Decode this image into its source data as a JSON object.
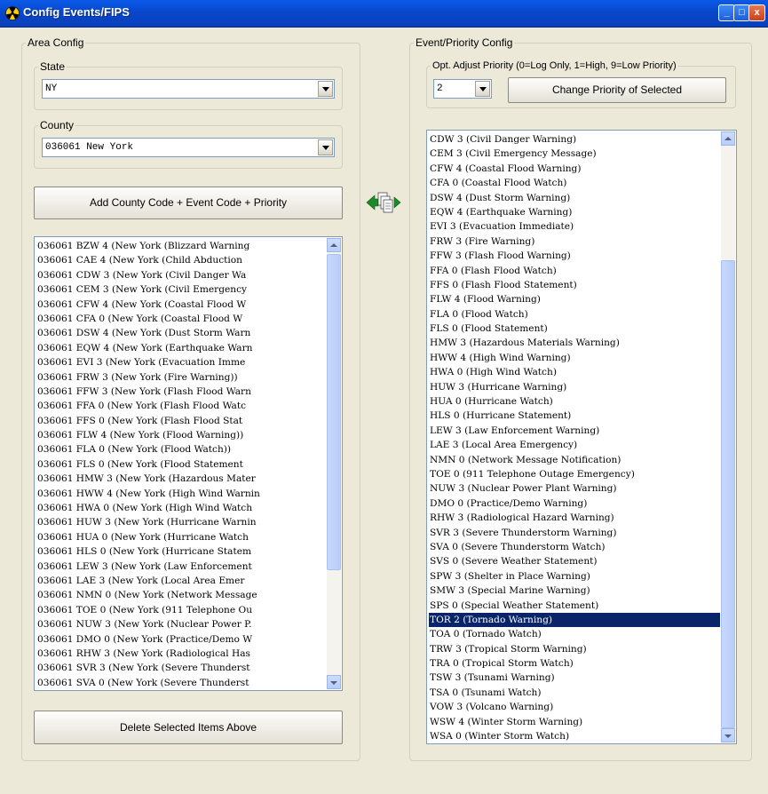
{
  "window": {
    "title": "Config Events/FIPS",
    "min_label": "_",
    "max_label": "□",
    "close_label": "x"
  },
  "area": {
    "legend": "Area Config",
    "state": {
      "legend": "State",
      "value": "NY"
    },
    "county": {
      "legend": "County",
      "value": "036061 New York"
    },
    "add_button": "Add County Code + Event Code + Priority",
    "delete_button": "Delete Selected Items Above",
    "items": [
      "036061 BZW 4 (New York (Blizzard Warning",
      "036061 CAE 4 (New York (Child Abduction",
      "036061 CDW 3 (New York (Civil Danger Wa",
      "036061 CEM 3 (New York (Civil Emergency",
      "036061 CFW 4 (New York (Coastal Flood W",
      "036061 CFA 0 (New York (Coastal Flood W",
      "036061 DSW 4 (New York (Dust Storm Warn",
      "036061 EQW 4 (New York (Earthquake Warn",
      "036061 EVI 3 (New York (Evacuation Imme",
      "036061 FRW 3 (New York (Fire Warning))",
      "036061 FFW 3 (New York (Flash Flood Warn",
      "036061 FFA 0 (New York (Flash Flood Watc",
      "036061 FFS 0 (New York (Flash Flood Stat",
      "036061 FLW 4 (New York (Flood Warning))",
      "036061 FLA 0 (New York (Flood Watch))",
      "036061 FLS 0 (New York (Flood Statement",
      "036061 HMW 3 (New York (Hazardous Mater",
      "036061 HWW 4 (New York (High Wind Warnin",
      "036061 HWA 0 (New York (High Wind Watch",
      "036061 HUW 3 (New York (Hurricane Warnin",
      "036061 HUA 0 (New York (Hurricane Watch",
      "036061 HLS 0 (New York (Hurricane Statem",
      "036061 LEW 3 (New York (Law Enforcement",
      "036061 LAE 3 (New York (Local Area Emer",
      "036061 NMN 0 (New York (Network Message",
      "036061 TOE 0 (New York (911 Telephone Ou",
      "036061 NUW 3 (New York (Nuclear Power P.",
      "036061 DMO 0 (New York (Practice/Demo W",
      "036061 RHW 3 (New York (Radiological Has",
      "036061 SVR 3 (New York (Severe Thunderst",
      "036061 SVA 0 (New York (Severe Thunderst"
    ]
  },
  "event": {
    "legend": "Event/Priority Config",
    "priority": {
      "legend": "Opt. Adjust Priority (0=Log Only, 1=High, 9=Low Priority)",
      "value": "2"
    },
    "change_button": "Change Priority of Selected",
    "selected_index": 31,
    "items": [
      "CDW 3 (Civil Danger Warning)",
      "CEM 3 (Civil Emergency Message)",
      "CFW 4 (Coastal Flood Warning)",
      "CFA 0 (Coastal Flood Watch)",
      "DSW 4 (Dust Storm Warning)",
      "EQW 4 (Earthquake Warning)",
      "EVI 3 (Evacuation Immediate)",
      "FRW 3 (Fire Warning)",
      "FFW 3 (Flash Flood Warning)",
      "FFA 0 (Flash Flood Watch)",
      "FFS 0 (Flash Flood Statement)",
      "FLW 4 (Flood Warning)",
      "FLA 0 (Flood Watch)",
      "FLS 0 (Flood Statement)",
      "HMW 3 (Hazardous Materials Warning)",
      "HWW 4 (High Wind Warning)",
      "HWA 0 (High Wind Watch)",
      "HUW 3 (Hurricane Warning)",
      "HUA 0 (Hurricane Watch)",
      "HLS 0 (Hurricane Statement)",
      "LEW 3 (Law Enforcement Warning)",
      "LAE 3 (Local Area Emergency)",
      "NMN 0 (Network Message Notification)",
      "TOE 0 (911 Telephone Outage Emergency)",
      "NUW 3 (Nuclear Power Plant Warning)",
      "DMO 0 (Practice/Demo Warning)",
      "RHW 3 (Radiological Hazard Warning)",
      "SVR 3 (Severe Thunderstorm Warning)",
      "SVA 0 (Severe Thunderstorm Watch)",
      "SVS 0 (Severe Weather Statement)",
      "SPW 3 (Shelter in Place Warning)",
      "SMW 3 (Special Marine Warning)",
      "SPS 0 (Special Weather Statement)",
      "TOR 2 (Tornado Warning)",
      "TOA 0 (Tornado Watch)",
      "TRW 3 (Tropical Storm Warning)",
      "TRA 0 (Tropical Storm Watch)",
      "TSW 3 (Tsunami Warning)",
      "TSA 0 (Tsunami Watch)",
      "VOW 3 (Volcano Warning)",
      "WSW 4 (Winter Storm Warning)",
      "WSA 0 (Winter Storm Watch)"
    ]
  },
  "icons": {
    "app": "radiation-icon",
    "transfer": "transfer-arrows-icon"
  }
}
